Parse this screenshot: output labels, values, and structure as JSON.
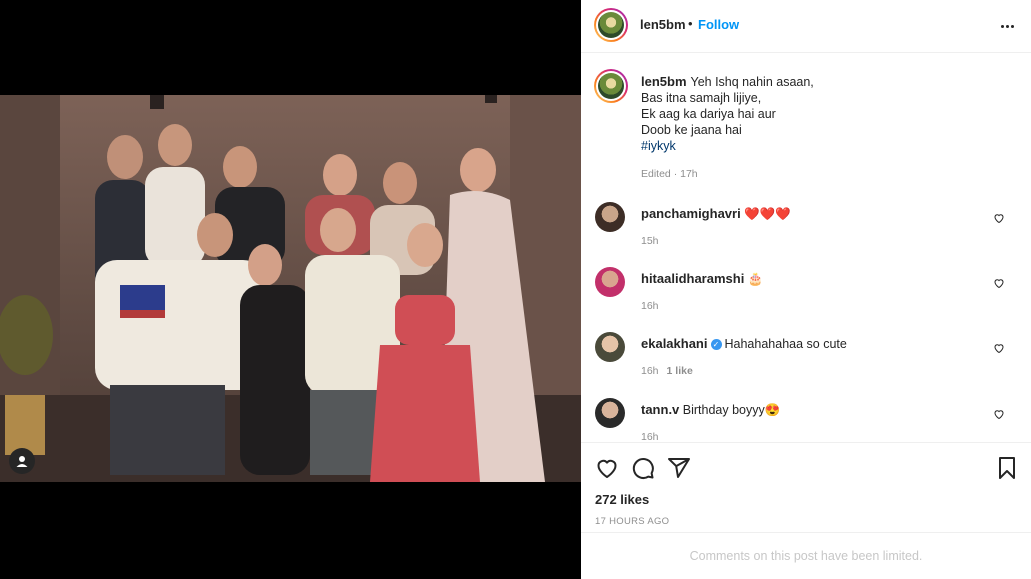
{
  "post": {
    "author": "len5bm",
    "follow_label": "Follow",
    "separator": "•",
    "caption_lines": [
      "Yeh Ishq nahin asaan,",
      "Bas itna samajh lijiye,",
      "Ek aag ka dariya hai aur",
      "Doob ke jaana hai"
    ],
    "hashtag": "#iykyk",
    "caption_meta": "Edited · 17h"
  },
  "comments": [
    {
      "user": "panchamighavri",
      "text": "❤️❤️❤️",
      "time": "15h",
      "likes": "",
      "verified": false
    },
    {
      "user": "hitaalidharamshi",
      "text": "🎂",
      "time": "16h",
      "likes": "",
      "verified": false
    },
    {
      "user": "ekalakhani",
      "text": "Hahahahahaa so cute",
      "time": "16h",
      "likes": "1 like",
      "verified": true
    },
    {
      "user": "tann.v",
      "text": "Birthday boyyy😍",
      "time": "16h",
      "likes": "",
      "verified": false
    }
  ],
  "actions": {
    "like_count": "272 likes",
    "posted_time": "17 HOURS AGO"
  },
  "footer": {
    "limited_text": "Comments on this post have been limited."
  },
  "icons": {
    "more": "more-options-icon",
    "like": "heart-icon",
    "comment": "comment-icon",
    "share": "share-icon",
    "save": "bookmark-icon",
    "tag": "user-tag-icon"
  },
  "colors": {
    "accent": "#0095f6",
    "muted": "#8e8e8e",
    "limited": "#c7c7c7",
    "heart_red": "#ed4956"
  }
}
